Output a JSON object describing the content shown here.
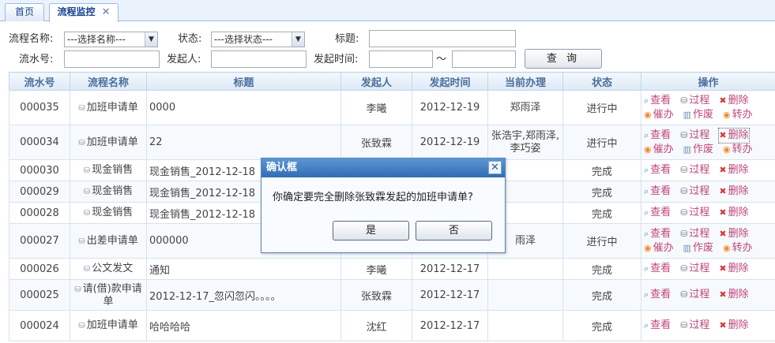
{
  "tabs": [
    {
      "label": "首页",
      "active": false
    },
    {
      "label": "流程监控",
      "active": true,
      "close": "✕"
    }
  ],
  "search": {
    "flow_name_label": "流程名称:",
    "flow_name_value": "---选择名称---",
    "status_label": "状态:",
    "status_value": "---选择状态---",
    "title_label": "标题:",
    "serial_label": "流水号:",
    "initiator_label": "发起人:",
    "time_label": "发起时间:",
    "time_sep": "～",
    "query_button": "查 询"
  },
  "table": {
    "headers": [
      "流水号",
      "流程名称",
      "标题",
      "发起人",
      "发起时间",
      "当前办理",
      "状态",
      "操作"
    ],
    "op_labels": {
      "view": "查看",
      "process": "过程",
      "delete": "删除",
      "urge": "催办",
      "void": "作废",
      "transfer": "转办"
    },
    "rows": [
      {
        "serial": "000035",
        "flow": "加班申请单",
        "title": "0000",
        "initiator": "李曦",
        "date": "2012-12-19",
        "handler": "郑雨泽",
        "status": "进行中",
        "full_ops": true
      },
      {
        "serial": "000034",
        "flow": "加班申请单",
        "title": "22",
        "initiator": "张致霖",
        "date": "2012-12-19",
        "handler": "张浩宇,郑雨泽,李巧姿",
        "status": "进行中",
        "full_ops": true
      },
      {
        "serial": "000030",
        "flow": "现金销售",
        "title": "现金销售_2012-12-18",
        "initiator": "",
        "date": "",
        "handler": "",
        "status": "完成",
        "full_ops": false
      },
      {
        "serial": "000029",
        "flow": "现金销售",
        "title": "现金销售_2012-12-18",
        "initiator": "",
        "date": "",
        "handler": "",
        "status": "完成",
        "full_ops": false
      },
      {
        "serial": "000028",
        "flow": "现金销售",
        "title": "现金销售_2012-12-18",
        "initiator": "",
        "date": "",
        "handler": "",
        "status": "完成",
        "full_ops": false
      },
      {
        "serial": "000027",
        "flow": "出差申请单",
        "title": "000000",
        "initiator": "",
        "date": "",
        "handler": "雨泽",
        "status": "进行中",
        "full_ops": true
      },
      {
        "serial": "000026",
        "flow": "公文发文",
        "title": "通知",
        "initiator": "李曦",
        "date": "2012-12-17",
        "handler": "",
        "status": "完成",
        "full_ops": false
      },
      {
        "serial": "000025",
        "flow": "请(借)款申请单",
        "title": "2012-12-17_忽闪忽闪。。。。",
        "initiator": "张致霖",
        "date": "2012-12-17",
        "handler": "",
        "status": "完成",
        "full_ops": false
      },
      {
        "serial": "000024",
        "flow": "加班申请单",
        "title": "哈哈哈哈",
        "initiator": "沈红",
        "date": "2012-12-17",
        "handler": "",
        "status": "完成",
        "full_ops": false
      }
    ]
  },
  "dialog": {
    "title": "确认框",
    "close": "✕",
    "message": "你确定要完全删除张致霖发起的加班申请单?",
    "yes": "是",
    "no": "否"
  }
}
